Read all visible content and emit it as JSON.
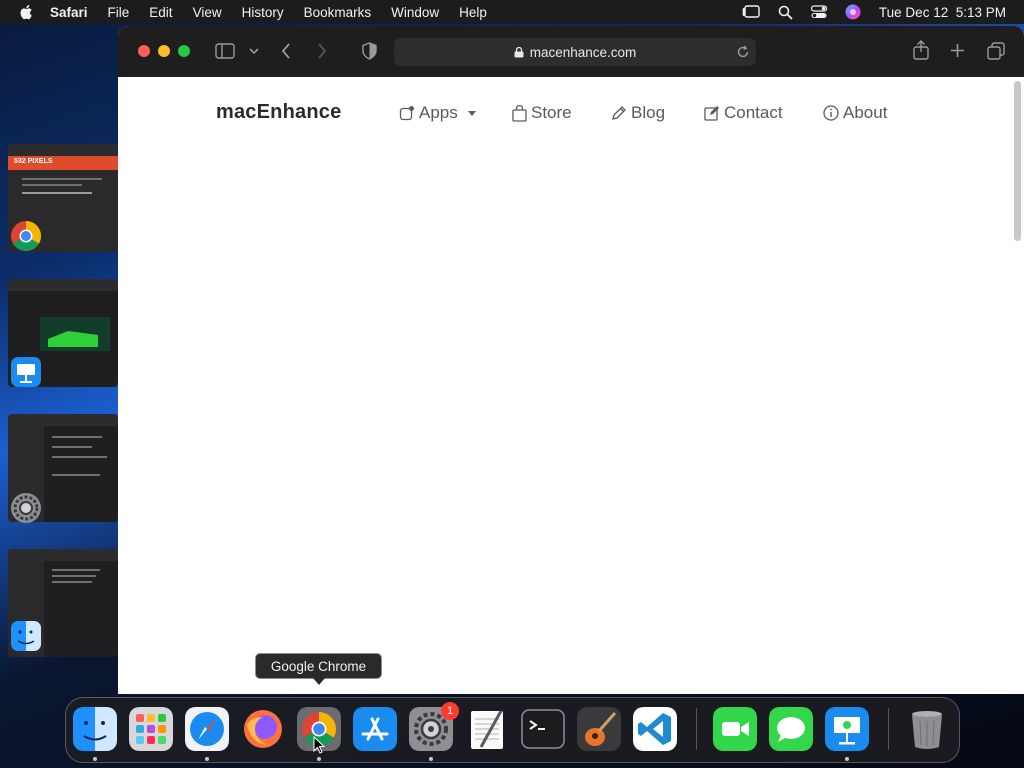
{
  "menubar": {
    "app_name": "Safari",
    "items": [
      "File",
      "Edit",
      "View",
      "History",
      "Bookmarks",
      "Window",
      "Help"
    ],
    "clock": "Tue Dec 12  5:13 PM"
  },
  "stage_manager": {
    "thumb1_text": "532 PIXELS"
  },
  "browser": {
    "url": "macenhance.com"
  },
  "site": {
    "brand": "macEnhance",
    "nav": {
      "apps": "Apps",
      "store": "Store",
      "blog": "Blog",
      "contact": "Contact",
      "about": "About"
    }
  },
  "tooltip": {
    "text": "Google Chrome"
  },
  "dock": {
    "system_settings_badge": "1"
  },
  "colors": {
    "traffic_red": "#ff5f57",
    "traffic_yellow": "#febc2e",
    "traffic_green": "#28c840",
    "badge_red": "#ff3b30"
  }
}
